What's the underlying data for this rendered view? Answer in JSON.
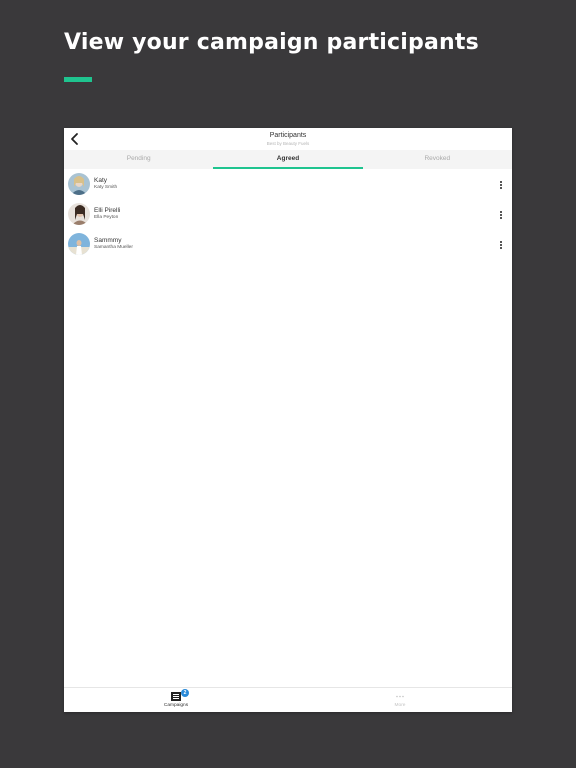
{
  "promo": {
    "headline": "View your campaign participants",
    "accent_color": "#1fc48f"
  },
  "header": {
    "title": "Participants",
    "subtitle": "Best by Beauty Fuels",
    "back_icon": "chevron-left-icon"
  },
  "tabs": [
    {
      "label": "Pending",
      "active": false
    },
    {
      "label": "Agreed",
      "active": true
    },
    {
      "label": "Revoked",
      "active": false
    }
  ],
  "participants": [
    {
      "name": "Katy",
      "full_name": "Katy Smith",
      "avatar_color": "#9fb8c8"
    },
    {
      "name": "Elli Pirelli",
      "full_name": "Ella Peyton",
      "avatar_color": "#c9b8ad"
    },
    {
      "name": "Sammmy",
      "full_name": "Samantha Mueller",
      "avatar_color": "#6fa6cf"
    }
  ],
  "tabbar": {
    "items": [
      {
        "label": "Campaigns",
        "icon": "list-icon",
        "badge": "2",
        "active": true
      },
      {
        "label": "More",
        "icon": "ellipsis-icon",
        "active": false
      }
    ]
  }
}
